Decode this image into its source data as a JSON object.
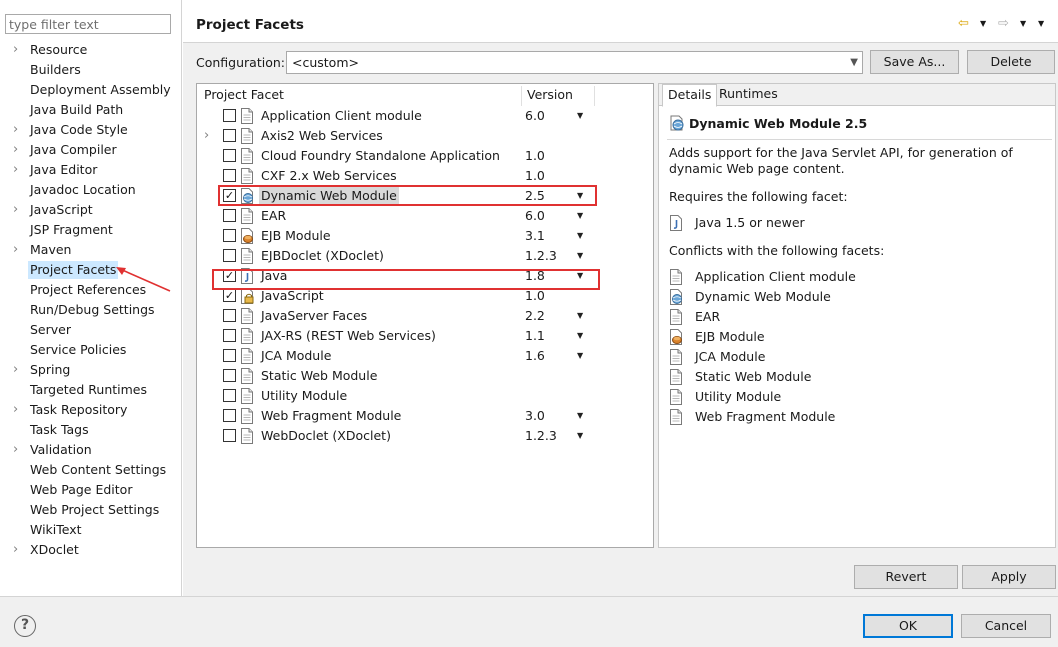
{
  "filter": {
    "placeholder": "type filter text"
  },
  "tree": {
    "items": [
      {
        "label": "Resource",
        "expandable": true
      },
      {
        "label": "Builders",
        "expandable": false
      },
      {
        "label": "Deployment Assembly",
        "expandable": false
      },
      {
        "label": "Java Build Path",
        "expandable": false
      },
      {
        "label": "Java Code Style",
        "expandable": true
      },
      {
        "label": "Java Compiler",
        "expandable": true
      },
      {
        "label": "Java Editor",
        "expandable": true
      },
      {
        "label": "Javadoc Location",
        "expandable": false
      },
      {
        "label": "JavaScript",
        "expandable": true
      },
      {
        "label": "JSP Fragment",
        "expandable": false
      },
      {
        "label": "Maven",
        "expandable": true
      },
      {
        "label": "Project Facets",
        "expandable": false,
        "selected": true
      },
      {
        "label": "Project References",
        "expandable": false
      },
      {
        "label": "Run/Debug Settings",
        "expandable": false
      },
      {
        "label": "Server",
        "expandable": false
      },
      {
        "label": "Service Policies",
        "expandable": false
      },
      {
        "label": "Spring",
        "expandable": true
      },
      {
        "label": "Targeted Runtimes",
        "expandable": false
      },
      {
        "label": "Task Repository",
        "expandable": true
      },
      {
        "label": "Task Tags",
        "expandable": false
      },
      {
        "label": "Validation",
        "expandable": true
      },
      {
        "label": "Web Content Settings",
        "expandable": false
      },
      {
        "label": "Web Page Editor",
        "expandable": false
      },
      {
        "label": "Web Project Settings",
        "expandable": false
      },
      {
        "label": "WikiText",
        "expandable": false
      },
      {
        "label": "XDoclet",
        "expandable": true
      }
    ]
  },
  "header": {
    "title": "Project Facets"
  },
  "config": {
    "label": "Configuration:",
    "value": "<custom>",
    "save_as": "Save As...",
    "delete": "Delete"
  },
  "facets": {
    "col_facet": "Project Facet",
    "col_version": "Version",
    "rows": [
      {
        "name": "Application Client module",
        "version": "6.0",
        "checked": false,
        "dropdown": true,
        "icon": "page-icon",
        "expandable": false
      },
      {
        "name": "Axis2 Web Services",
        "version": "",
        "checked": false,
        "dropdown": false,
        "icon": "page-icon",
        "expandable": true
      },
      {
        "name": "Cloud Foundry Standalone Application",
        "version": "1.0",
        "checked": false,
        "dropdown": false,
        "icon": "page-icon",
        "expandable": false
      },
      {
        "name": "CXF 2.x Web Services",
        "version": "1.0",
        "checked": false,
        "dropdown": false,
        "icon": "page-icon",
        "expandable": false
      },
      {
        "name": "Dynamic Web Module",
        "version": "2.5",
        "checked": true,
        "dropdown": true,
        "icon": "web-module-icon",
        "expandable": false,
        "highlight": true
      },
      {
        "name": "EAR",
        "version": "6.0",
        "checked": false,
        "dropdown": true,
        "icon": "page-icon",
        "expandable": false
      },
      {
        "name": "EJB Module",
        "version": "3.1",
        "checked": false,
        "dropdown": true,
        "icon": "ejb-icon",
        "expandable": false
      },
      {
        "name": "EJBDoclet (XDoclet)",
        "version": "1.2.3",
        "checked": false,
        "dropdown": true,
        "icon": "page-icon",
        "expandable": false
      },
      {
        "name": "Java",
        "version": "1.8",
        "checked": true,
        "dropdown": true,
        "icon": "java-icon",
        "expandable": false
      },
      {
        "name": "JavaScript",
        "version": "1.0",
        "checked": true,
        "dropdown": false,
        "icon": "js-locked-icon",
        "expandable": false
      },
      {
        "name": "JavaServer Faces",
        "version": "2.2",
        "checked": false,
        "dropdown": true,
        "icon": "page-icon",
        "expandable": false
      },
      {
        "name": "JAX-RS (REST Web Services)",
        "version": "1.1",
        "checked": false,
        "dropdown": true,
        "icon": "page-icon",
        "expandable": false
      },
      {
        "name": "JCA Module",
        "version": "1.6",
        "checked": false,
        "dropdown": true,
        "icon": "page-icon",
        "expandable": false
      },
      {
        "name": "Static Web Module",
        "version": "",
        "checked": false,
        "dropdown": false,
        "icon": "page-icon",
        "expandable": false
      },
      {
        "name": "Utility Module",
        "version": "",
        "checked": false,
        "dropdown": false,
        "icon": "page-icon",
        "expandable": false
      },
      {
        "name": "Web Fragment Module",
        "version": "3.0",
        "checked": false,
        "dropdown": true,
        "icon": "page-icon",
        "expandable": false
      },
      {
        "name": "WebDoclet (XDoclet)",
        "version": "1.2.3",
        "checked": false,
        "dropdown": true,
        "icon": "page-icon",
        "expandable": false
      }
    ]
  },
  "details": {
    "tabs": [
      "Details",
      "Runtimes"
    ],
    "title": "Dynamic Web Module 2.5",
    "description": "Adds support for the Java Servlet API, for generation of dynamic Web page content.",
    "requires_label": "Requires the following facet:",
    "requires": [
      {
        "label": "Java 1.5 or newer",
        "icon": "java-icon"
      }
    ],
    "conflicts_label": "Conflicts with the following facets:",
    "conflicts": [
      {
        "label": "Application Client module",
        "icon": "page-icon"
      },
      {
        "label": "Dynamic Web Module",
        "icon": "web-module-icon"
      },
      {
        "label": "EAR",
        "icon": "page-icon"
      },
      {
        "label": "EJB Module",
        "icon": "ejb-icon"
      },
      {
        "label": "JCA Module",
        "icon": "page-icon"
      },
      {
        "label": "Static Web Module",
        "icon": "page-icon"
      },
      {
        "label": "Utility Module",
        "icon": "page-icon"
      },
      {
        "label": "Web Fragment Module",
        "icon": "page-icon"
      }
    ]
  },
  "actions": {
    "revert": "Revert",
    "apply": "Apply",
    "ok": "OK",
    "cancel": "Cancel",
    "help": "?"
  },
  "colors": {
    "selection": "#cce8ff",
    "annotation_red": "#e03131",
    "default_button_border": "#0078d7"
  }
}
